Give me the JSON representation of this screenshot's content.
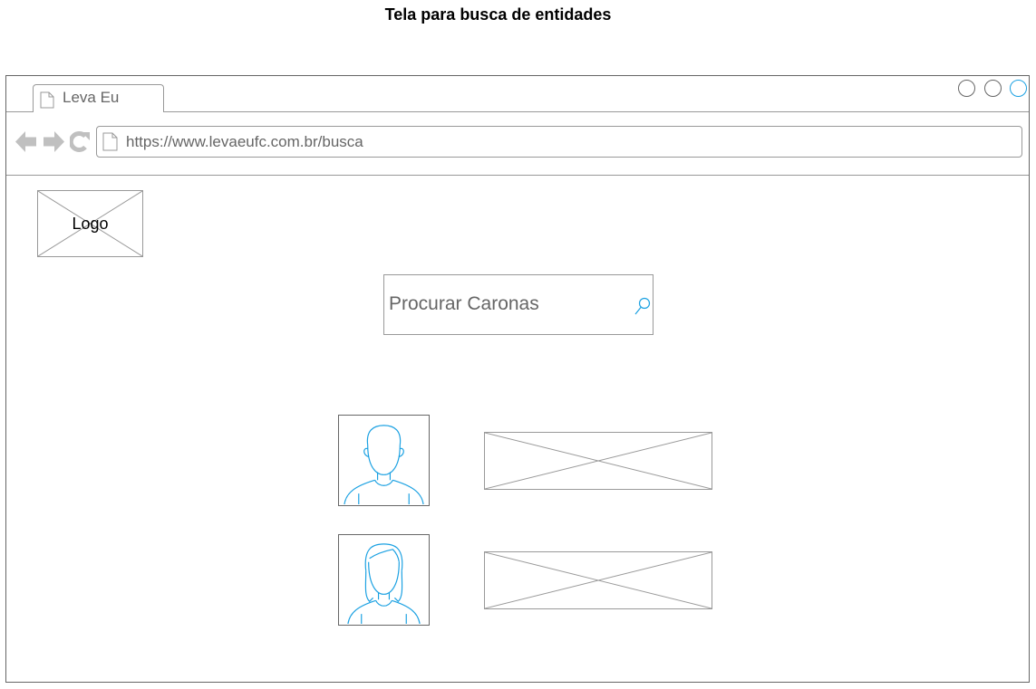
{
  "page": {
    "title": "Tela para busca de entidades"
  },
  "browser": {
    "tab_title": "Leva Eu",
    "url": "https://www.levaeufc.com.br/busca",
    "nav_icons": [
      "back-arrow-icon",
      "forward-arrow-icon",
      "reload-icon"
    ],
    "window_controls": [
      "minimize-circle",
      "maximize-circle",
      "close-circle"
    ]
  },
  "content": {
    "logo_label": "Logo",
    "search": {
      "placeholder": "Procurar Caronas",
      "icon": "search-icon"
    },
    "results": [
      {
        "avatar": "male-user-icon",
        "info": "image-placeholder"
      },
      {
        "avatar": "female-user-icon",
        "info": "image-placeholder"
      }
    ]
  },
  "colors": {
    "accent": "#1ba1e2",
    "border": "#999999",
    "text_muted": "#666666"
  }
}
